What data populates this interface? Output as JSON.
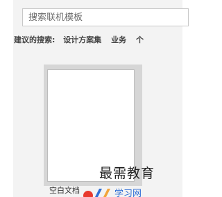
{
  "search": {
    "placeholder": "搜索联机模板",
    "value": ""
  },
  "suggestions": {
    "label": "建议的搜索:",
    "items": [
      "设计方案集",
      "业务",
      "个"
    ]
  },
  "templates": [
    {
      "caption": "空白文档"
    }
  ],
  "watermark": {
    "text": "最需教育",
    "logo_text": "学习网"
  },
  "colors": {
    "page_bg": "#f3f3f3",
    "card_bg": "#d6d6d6",
    "logo_red": "#e8392d",
    "logo_blue": "#2f6fd6"
  }
}
